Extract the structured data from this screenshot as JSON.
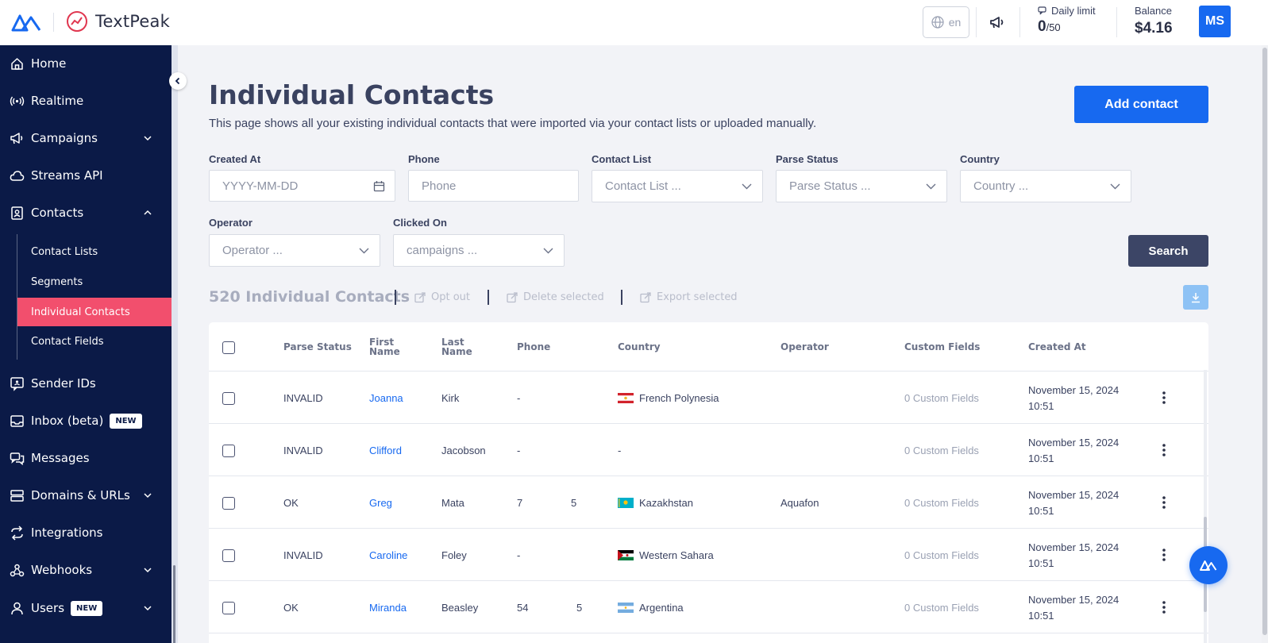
{
  "brand": {
    "name": "TextPeak"
  },
  "topbar": {
    "language": "en",
    "daily_limit_label": "Daily limit",
    "daily_limit_used": "0",
    "daily_limit_total": "/50",
    "balance_label": "Balance",
    "balance_value": "$4.16",
    "avatar_initials": "MS"
  },
  "sidebar": {
    "items": [
      {
        "label": "Home",
        "icon": "home-icon"
      },
      {
        "label": "Realtime",
        "icon": "broadcast-icon"
      },
      {
        "label": "Campaigns",
        "icon": "megaphone-icon"
      },
      {
        "label": "Streams API",
        "icon": "cloud-icon"
      },
      {
        "label": "Contacts",
        "icon": "contacts-icon"
      },
      {
        "label": "Sender IDs",
        "icon": "sender-id-icon"
      },
      {
        "label": "Inbox (beta)",
        "icon": "inbox-icon",
        "badge": "NEW"
      },
      {
        "label": "Messages",
        "icon": "messages-icon"
      },
      {
        "label": "Domains & URLs",
        "icon": "server-icon"
      },
      {
        "label": "Integrations",
        "icon": "integrations-icon"
      },
      {
        "label": "Webhooks",
        "icon": "webhook-icon"
      },
      {
        "label": "Users",
        "icon": "user-icon",
        "badge": "NEW"
      }
    ],
    "contacts_sub": [
      "Contact Lists",
      "Segments",
      "Individual Contacts",
      "Contact Fields"
    ],
    "active_sub": "Individual Contacts"
  },
  "page": {
    "title": "Individual Contacts",
    "description": "This page shows all your existing individual contacts that were imported via your contact lists or uploaded manually.",
    "add_button": "Add contact"
  },
  "filters": {
    "created_at": {
      "label": "Created At",
      "placeholder": "YYYY-MM-DD"
    },
    "phone": {
      "label": "Phone",
      "placeholder": "Phone"
    },
    "contact_list": {
      "label": "Contact List",
      "placeholder": "Contact List ..."
    },
    "parse_status": {
      "label": "Parse Status",
      "placeholder": "Parse Status ..."
    },
    "country": {
      "label": "Country",
      "placeholder": "Country ..."
    },
    "operator": {
      "label": "Operator",
      "placeholder": "Operator ..."
    },
    "clicked_on": {
      "label": "Clicked On",
      "placeholder": "campaigns ..."
    },
    "search_button": "Search"
  },
  "list": {
    "count_title": "520 Individual Contacts",
    "opt_out": "Opt out",
    "delete_selected": "Delete selected",
    "export_selected": "Export selected"
  },
  "table": {
    "headers": {
      "parse_status": "Parse Status",
      "first_name_1": "First",
      "first_name_2": "Name",
      "last_name_1": "Last",
      "last_name_2": "Name",
      "phone": "Phone",
      "country": "Country",
      "operator": "Operator",
      "custom_fields": "Custom Fields",
      "created_at": "Created At"
    },
    "rows": [
      {
        "status": "INVALID",
        "first": "Joanna",
        "last": "Kirk",
        "phone_a": "-",
        "phone_b": "",
        "country": "French Polynesia",
        "flag": "pf",
        "operator": "",
        "custom": "0 Custom Fields",
        "date": "November 15, 2024",
        "time": "10:51"
      },
      {
        "status": "INVALID",
        "first": "Clifford",
        "last": "Jacobson",
        "phone_a": "-",
        "phone_b": "",
        "country": "-",
        "flag": "",
        "operator": "",
        "custom": "0 Custom Fields",
        "date": "November 15, 2024",
        "time": "10:51"
      },
      {
        "status": "OK",
        "first": "Greg",
        "last": "Mata",
        "phone_a": "7",
        "phone_b": "5",
        "country": "Kazakhstan",
        "flag": "kz",
        "operator": "Aquafon",
        "custom": "0 Custom Fields",
        "date": "November 15, 2024",
        "time": "10:51"
      },
      {
        "status": "INVALID",
        "first": "Caroline",
        "last": "Foley",
        "phone_a": "-",
        "phone_b": "",
        "country": "Western Sahara",
        "flag": "eh",
        "operator": "",
        "custom": "0 Custom Fields",
        "date": "November 15, 2024",
        "time": "10:51"
      },
      {
        "status": "OK",
        "first": "Miranda",
        "last": "Beasley",
        "phone_a": "54",
        "phone_b": "5",
        "country": "Argentina",
        "flag": "ar",
        "operator": "",
        "custom": "0 Custom Fields",
        "date": "November 15, 2024",
        "time": "10:51"
      }
    ]
  },
  "colors": {
    "primary": "#1769f0",
    "sidebar": "#0b1a47",
    "active": "#f24f6d",
    "dark_button": "#3c4566"
  }
}
